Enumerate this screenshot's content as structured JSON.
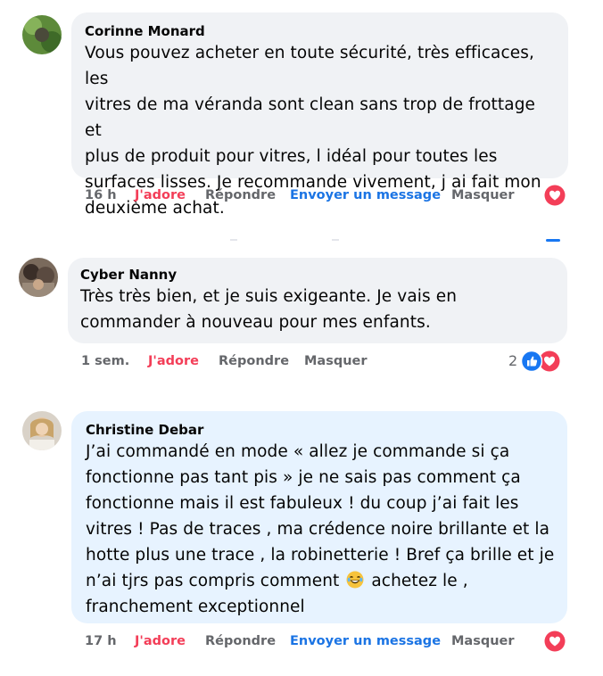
{
  "comments": [
    {
      "author": "Corinne Monard",
      "lines": [
        "Vous pouvez acheter en toute sécurité, très efficaces, les",
        "vitres de ma véranda sont clean sans trop de frottage et",
        "plus de produit pour vitres, l idéal pour toutes les",
        "surfaces lisses. Je recommande vivement, j ai fait mon",
        "deuxième achat."
      ],
      "time": "16 h",
      "like_label": "J'adore",
      "reply_label": "Répondre",
      "message_label": "Envoyer un message",
      "hide_label": "Masquer",
      "reactions": [
        "love"
      ]
    },
    {
      "author": "Cyber Nanny",
      "lines": [
        "Très très bien, et je suis exigeante. Je vais en",
        "commander à nouveau pour mes enfants."
      ],
      "time": "1 sem.",
      "like_label": "J'adore",
      "reply_label": "Répondre",
      "hide_label": "Masquer",
      "reaction_count": "2",
      "reactions": [
        "like",
        "love"
      ]
    },
    {
      "author": "Christine Debar",
      "lines": [
        "J’ai commandé en mode « allez je commande si ça",
        "fonctionne pas tant pis » je ne sais pas comment ça",
        "fonctionne mais il est fabuleux ! du coup j’ai fait les",
        "vitres ! Pas de traces , ma crédence noire brillante et la",
        "hotte plus une trace , la robinetterie ! Bref ça brille et je",
        "n’ai tjrs pas compris comment",
        "franchement exceptionnel"
      ],
      "line6_after_emoji": "achetez le ,",
      "emoji": "laughing-tears-emoji",
      "time": "17 h",
      "like_label": "J'adore",
      "reply_label": "Répondre",
      "message_label": "Envoyer un message",
      "hide_label": "Masquer",
      "reactions": [
        "love"
      ]
    }
  ],
  "colors": {
    "bubble_grey": "#f0f2f5",
    "bubble_blue": "#e7f3ff",
    "love_red": "#f33e58",
    "link_blue": "#1b74e4",
    "meta_grey": "#65676b",
    "like_blue": "#1877f2"
  }
}
